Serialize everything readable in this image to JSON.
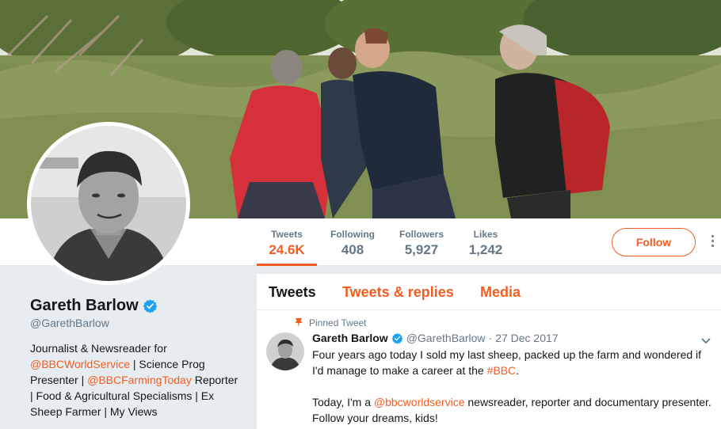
{
  "stats": {
    "tweets": {
      "label": "Tweets",
      "value": "24.6K"
    },
    "following": {
      "label": "Following",
      "value": "408"
    },
    "followers": {
      "label": "Followers",
      "value": "5,927"
    },
    "likes": {
      "label": "Likes",
      "value": "1,242"
    }
  },
  "follow_button": "Follow",
  "profile": {
    "name": "Gareth Barlow",
    "handle": "@GarethBarlow",
    "bio": {
      "line1": "Journalist & Newsreader for",
      "link1": "@BBCWorldService",
      "line2_after_link": " | Science Prog",
      "line3_before_link": "Presenter | ",
      "link2": "@BBCFarmingToday",
      "line3_after_link": " Reporter",
      "line4": "| Food & Agricultural Specialisms | Ex",
      "line5": "Sheep Farmer | My Views"
    }
  },
  "tabs": [
    "Tweets",
    "Tweets & replies",
    "Media"
  ],
  "pinned_label": "Pinned Tweet",
  "tweet": {
    "name": "Gareth Barlow",
    "handle": "@GarethBarlow",
    "separator": "·",
    "date": "27 Dec 2017",
    "line1": "Four years ago today I sold my last sheep, packed up the farm and wondered if",
    "line2_before": "I'd manage to make a career at the ",
    "line2_link": "#BBC",
    "line2_after": ".",
    "line3_before": "Today, I'm a ",
    "line3_link": "@bbcworldservice",
    "line3_after": " newsreader, reporter and documentary presenter.",
    "line4": "Follow your dreams, kids!"
  },
  "colors": {
    "accent": "#f45d22",
    "verified": "#1da1f2",
    "muted": "#657786",
    "text": "#14171a"
  },
  "icons": [
    "verified-badge-icon",
    "pin-icon",
    "chevron-down-icon",
    "more-options-icon"
  ]
}
